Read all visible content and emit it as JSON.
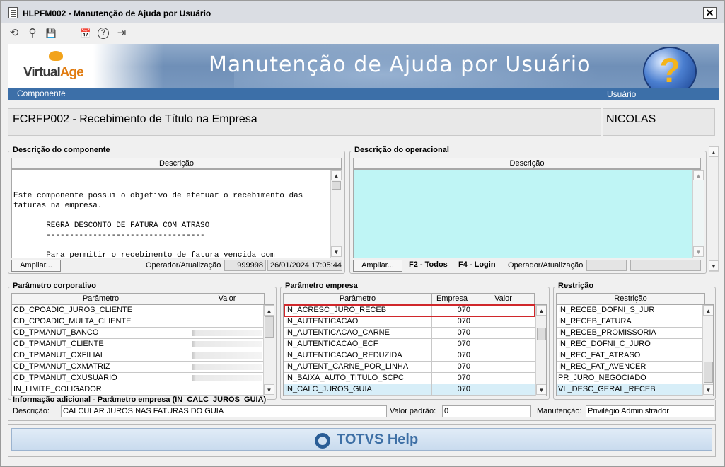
{
  "window": {
    "title": "HLPFM002 - Manutenção de Ajuda por Usuário",
    "close_label": "✕"
  },
  "toolbar": {
    "icons": [
      "undo-icon",
      "search-icon",
      "save-icon",
      "calendar-icon",
      "help-icon",
      "exit-icon"
    ],
    "glyphs": [
      "⟲",
      "⚲",
      "💾",
      "📅",
      "?",
      "⇥"
    ]
  },
  "banner": {
    "title": "Manutenção de Ajuda por Usuário",
    "logo_virtual": "Virtual",
    "logo_age": "Age",
    "label_component": "Componente",
    "label_user": "Usuário",
    "help_glyph": "?"
  },
  "header": {
    "component": "FCRFP002 - Recebimento de Título na Empresa",
    "user": "NICOLAS"
  },
  "comp_desc": {
    "group_label": "Descrição do componente",
    "column": "Descrição",
    "text": "Este componente possui o objetivo de efetuar o recebimento das\nfaturas na empresa.\n\n       REGRA DESCONTO DE FATURA COM ATRASO\n       ----------------------------------\n\n       Para permitir o recebimento de fatura vencida com\ndesconto deverá ser efetuado o seguinte:",
    "ampliar": "Ampliar...",
    "operator_label": "Operador/Atualização",
    "operator": "999998",
    "updated": "26/01/2024 17:05:44"
  },
  "oper_desc": {
    "group_label": "Descrição do operacional",
    "column": "Descrição",
    "ampliar": "Ampliar...",
    "f2": "F2 - Todos",
    "f4": "F4 - Login",
    "operator_label": "Operador/Atualização"
  },
  "param_corp": {
    "group_label": "Parâmetro corporativo",
    "col_param": "Parâmetro",
    "col_valor": "Valor",
    "rows": [
      {
        "param": "CD_CPOADIC_JUROS_CLIENTE",
        "valor": ""
      },
      {
        "param": "CD_CPOADIC_MULTA_CLIENTE",
        "valor": ""
      },
      {
        "param": "CD_TPMANUT_BANCO",
        "valor": ""
      },
      {
        "param": "CD_TPMANUT_CLIENTE",
        "valor": ""
      },
      {
        "param": "CD_TPMANUT_CXFILIAL",
        "valor": ""
      },
      {
        "param": "CD_TPMANUT_CXMATRIZ",
        "valor": ""
      },
      {
        "param": "CD_TPMANUT_CXUSUARIO",
        "valor": ""
      },
      {
        "param": "IN_LIMITE_COLIGADOR",
        "valor": ""
      }
    ]
  },
  "param_emp": {
    "group_label": "Parâmetro empresa",
    "col_param": "Parâmetro",
    "col_empresa": "Empresa",
    "col_valor": "Valor",
    "rows": [
      {
        "param": "IN_ACRESC_JURO_RECEB",
        "empresa": "070",
        "valor": ""
      },
      {
        "param": "IN_AUTENTICACAO",
        "empresa": "070",
        "valor": ""
      },
      {
        "param": "IN_AUTENTICACAO_CARNE",
        "empresa": "070",
        "valor": ""
      },
      {
        "param": "IN_AUTENTICACAO_ECF",
        "empresa": "070",
        "valor": ""
      },
      {
        "param": "IN_AUTENTICACAO_REDUZIDA",
        "empresa": "070",
        "valor": ""
      },
      {
        "param": "IN_AUTENT_CARNE_POR_LINHA",
        "empresa": "070",
        "valor": ""
      },
      {
        "param": "IN_BAIXA_AUTO_TITULO_SCPC",
        "empresa": "070",
        "valor": ""
      },
      {
        "param": "IN_CALC_JUROS_GUIA",
        "empresa": "070",
        "valor": ""
      }
    ]
  },
  "restricao": {
    "group_label": "Restrição",
    "column": "Restrição",
    "rows": [
      "IN_RECEB_DOFNI_S_JUR",
      "IN_RECEB_FATURA",
      "IN_RECEB_PROMISSORIA",
      "IN_REC_DOFNI_C_JURO",
      "IN_REC_FAT_ATRASO",
      "IN_REC_FAT_AVENCER",
      "PR_JURO_NEGOCIADO",
      "VL_DESC_GERAL_RECEB"
    ]
  },
  "info": {
    "group_label": "Informação adicional - Parâmetro empresa (IN_CALC_JUROS_GUIA)",
    "desc_label": "Descrição:",
    "desc_value": "CALCULAR JUROS NAS FATURAS DO GUIA",
    "default_label": "Valor padrão:",
    "default_value": "0",
    "maint_label": "Manutenção:",
    "maint_value": "Privilégio Administrador"
  },
  "footer": {
    "brand": "TOTVS Help"
  },
  "colors": {
    "banner": "#6f8fb7",
    "banner_bar": "#3c6fa8",
    "memo_bg": "#bff5f5",
    "selected_row": "#d7eef8",
    "highlight_border": "#d0272b"
  }
}
